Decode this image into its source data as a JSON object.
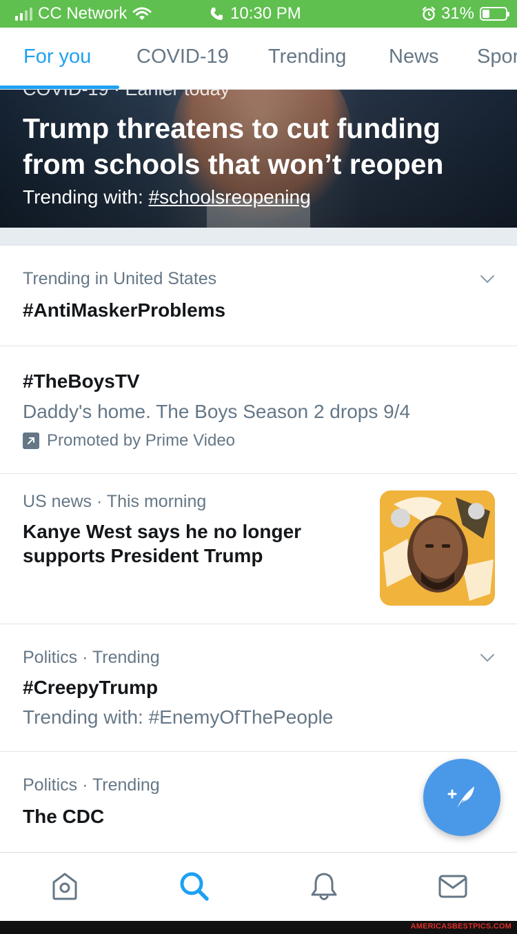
{
  "status_bar": {
    "carrier": "CC Network",
    "time": "10:30 PM",
    "battery": "31%",
    "battery_level": 0.31
  },
  "tabs": [
    {
      "label": "For you",
      "active": true
    },
    {
      "label": "COVID-19"
    },
    {
      "label": "Trending"
    },
    {
      "label": "News"
    },
    {
      "label": "Spor"
    }
  ],
  "hero": {
    "kicker": "COVID-19 · Earlier today",
    "title": "Trump threatens to cut funding from schools that won’t reopen",
    "trending_prefix": "Trending with: ",
    "trending_tag": "#schoolsreopening"
  },
  "items": [
    {
      "meta": "Trending in United States",
      "headline": "#AntiMaskerProblems"
    },
    {
      "headline": "#TheBoysTV",
      "description": "Daddy's home. The Boys Season 2 drops 9/4",
      "promoted": "Promoted by Prime Video"
    },
    {
      "meta": "US news · This morning",
      "headline": "Kanye West says he no longer supports President Trump"
    },
    {
      "meta": "Politics · Trending",
      "headline": "#CreepyTrump",
      "trending": "Trending with: #EnemyOfThePeople"
    },
    {
      "meta": "Politics · Trending",
      "headline": "The CDC"
    }
  ],
  "watermark": "AMERICASBESTPICS.COM",
  "colors": {
    "accent": "#1da1f2",
    "status_bar": "#5fbf4f",
    "fab": "#4a99e9",
    "secondary_text": "#657786"
  }
}
